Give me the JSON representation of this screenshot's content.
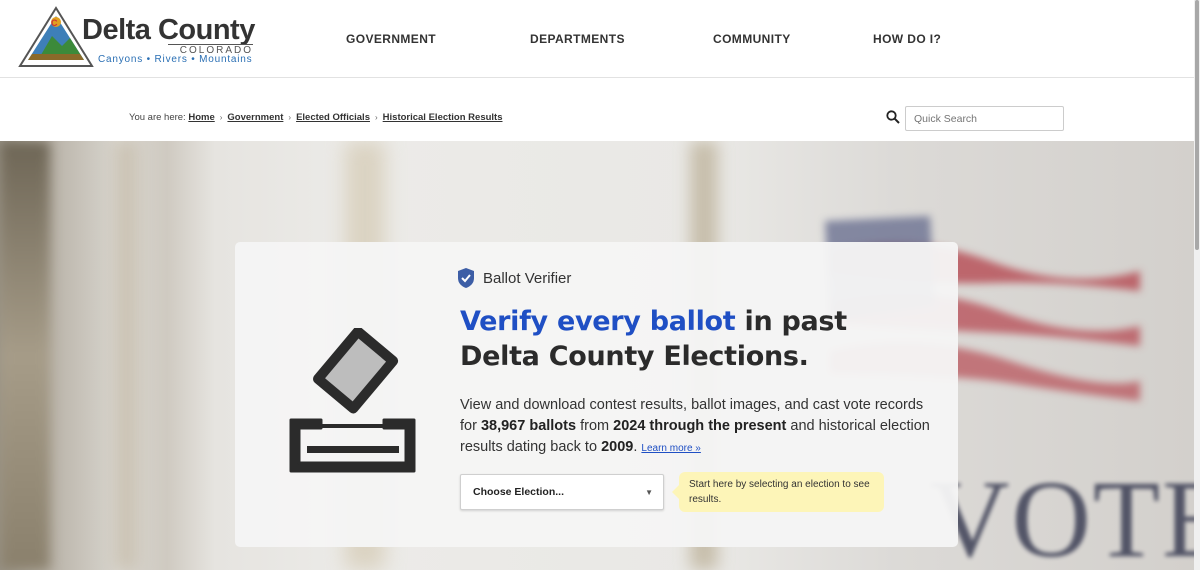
{
  "header": {
    "logo": {
      "name": "Delta County",
      "state": "COLORADO",
      "tagline": "Canyons • Rivers • Mountains"
    },
    "nav": [
      "GOVERNMENT",
      "DEPARTMENTS",
      "COMMUNITY",
      "HOW DO I?"
    ]
  },
  "breadcrumb": {
    "prefix": "You are here:",
    "items": [
      "Home",
      "Government",
      "Elected Officials",
      "Historical Election Results"
    ]
  },
  "search": {
    "placeholder": "Quick Search"
  },
  "hero": {
    "background_text": "VOTE"
  },
  "card": {
    "badge": "Ballot Verifier",
    "headline_highlight": "Verify every ballot",
    "headline_rest": " in past Delta County Elections.",
    "desc_1": "View and download contest results, ballot images, and cast vote records for ",
    "desc_ballots": "38,967 ballots",
    "desc_2": " from ",
    "desc_range": "2024 through the present",
    "desc_3": " and historical election results dating back to ",
    "desc_year": "2009",
    "desc_4": ".",
    "learn_more": "Learn more »",
    "select_value": "Choose Election...",
    "tooltip": "Start here by selecting an election to see results."
  },
  "colors": {
    "accent": "#1f4fc4",
    "tooltip_bg": "#fdf5b8"
  },
  "icons": {
    "shield": "shield-check-icon",
    "ballot": "ballot-box-icon",
    "search": "search-icon",
    "chevron": "chevron-down-icon"
  }
}
